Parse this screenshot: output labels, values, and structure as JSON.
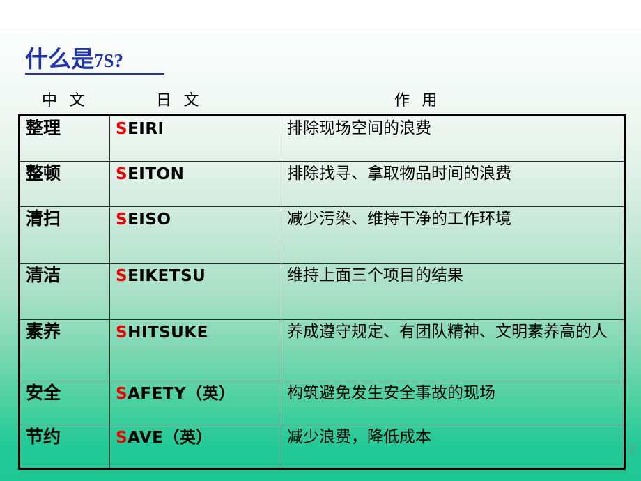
{
  "slide": {
    "title_cn": "什么是",
    "title_en": "7S?",
    "page_number": "2",
    "accent_color": "#2233a8",
    "highlight_color": "#ee0000",
    "background_top_color": "#ffffff",
    "background_bottom_color": "#1ec894"
  },
  "column_headers": {
    "chinese": "中 文",
    "japanese": "日 文",
    "purpose": "作  用"
  },
  "rows": [
    {
      "chinese": "整理",
      "initial": "S",
      "romaji_rest": "EIRI",
      "purpose": "排除现场空间的浪费"
    },
    {
      "chinese": "整顿",
      "initial": "S",
      "romaji_rest": "EITON",
      "purpose": "排除找寻、拿取物品时间的浪费"
    },
    {
      "chinese": "清扫",
      "initial": "S",
      "romaji_rest": "EISO",
      "purpose": "减少污染、维持干净的工作环境"
    },
    {
      "chinese": "清洁",
      "initial": "S",
      "romaji_rest": "EIKETSU",
      "purpose": "维持上面三个项目的结果"
    },
    {
      "chinese": "素养",
      "initial": "S",
      "romaji_rest": "HITSUKE",
      "purpose": "养成遵守规定、有团队精神、文明素养高的人"
    },
    {
      "chinese": "安全",
      "initial": "S",
      "romaji_rest": "AFETY（英）",
      "purpose": "构筑避免发生安全事故的现场"
    },
    {
      "chinese": "节约",
      "initial": "S",
      "romaji_rest": "AVE（英）",
      "purpose": "减少浪费，降低成本"
    }
  ]
}
